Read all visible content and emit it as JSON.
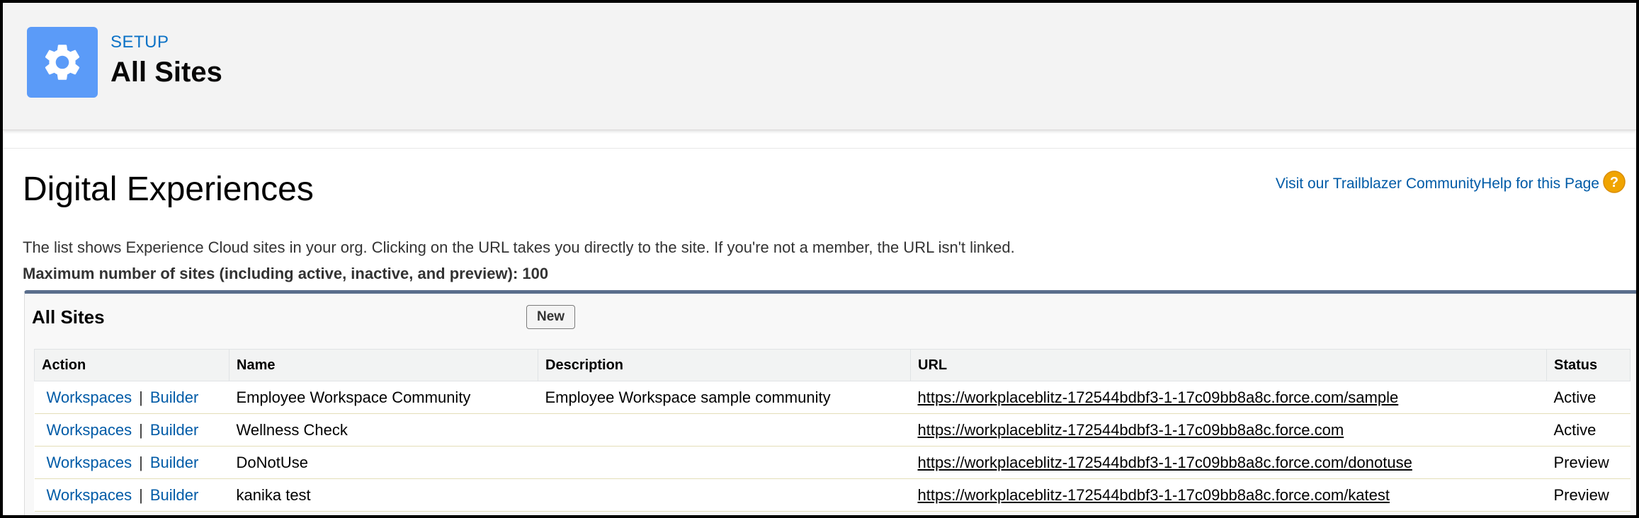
{
  "header": {
    "setup_label": "SETUP",
    "title": "All Sites",
    "icon": "gear-icon",
    "icon_tile_color": "#5b9bf8"
  },
  "main": {
    "section_title": "Digital Experiences",
    "help": {
      "trailblazer_link": "Visit our Trailblazer Community",
      "help_link": "Help for this Page",
      "icon": "help-icon"
    },
    "description": "The list shows Experience Cloud sites in your org. Clicking on the URL takes you directly to the site. If you're not a member, the URL isn't linked.",
    "max_sites_note": "Maximum number of sites (including active, inactive, and preview): 100"
  },
  "panel": {
    "title": "All Sites",
    "new_button_label": "New",
    "columns": [
      "Action",
      "Name",
      "Description",
      "URL",
      "Status"
    ],
    "action_labels": {
      "workspaces": "Workspaces",
      "separator": "|",
      "builder": "Builder"
    },
    "rows": [
      {
        "name": "Employee Workspace Community",
        "description": "Employee Workspace sample community",
        "url": "https://workplaceblitz-172544bdbf3-1-17c09bb8a8c.force.com/sample",
        "status": "Active"
      },
      {
        "name": "Wellness Check",
        "description": "",
        "url": "https://workplaceblitz-172544bdbf3-1-17c09bb8a8c.force.com",
        "status": "Active"
      },
      {
        "name": "DoNotUse",
        "description": "",
        "url": "https://workplaceblitz-172544bdbf3-1-17c09bb8a8c.force.com/donotuse",
        "status": "Preview"
      },
      {
        "name": "kanika test",
        "description": "",
        "url": "https://workplaceblitz-172544bdbf3-1-17c09bb8a8c.force.com/katest",
        "status": "Preview"
      }
    ]
  },
  "colors": {
    "link_blue": "#015ba7",
    "setup_blue": "#0b72c6",
    "panel_top_border": "#5a6e8c",
    "help_icon_orange": "#f0a400"
  }
}
